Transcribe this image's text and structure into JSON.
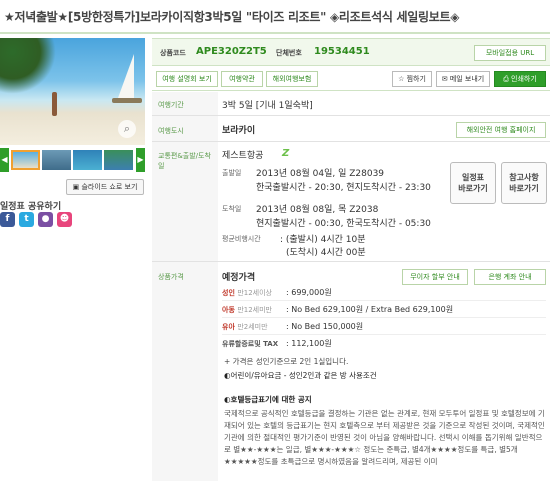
{
  "page": {
    "title": "★저녁출발★[5방한정특가]보라카이직항3박5일 \"타이즈 리조트\" ◈리조트석식 세일링보트◈"
  },
  "gallery": {
    "slideshow_label": "슬라이드 쇼로 보기",
    "share_label": "일정표 공유하기",
    "social": [
      {
        "icon": "facebook-icon",
        "glyph": "f",
        "color": "#3b5998"
      },
      {
        "icon": "twitter-icon",
        "glyph": "t",
        "color": "#2aa9e0"
      },
      {
        "icon": "messenger-icon",
        "glyph": "●",
        "color": "#7b4fa3"
      },
      {
        "icon": "kakao-icon",
        "glyph": "☻",
        "color": "#e8457c"
      }
    ]
  },
  "product": {
    "code_label": "상품코드",
    "code_value": "APE320Z2T5",
    "group_label": "단체번호",
    "group_value": "19534451",
    "mobile_url_label": "모바일접용 URL"
  },
  "tabs": [
    "여행 설명회 보기",
    "여행약관",
    "해외여행보험"
  ],
  "tools": {
    "bookmark": "☆ 찜하기",
    "mail": "✉ 메일 보내기",
    "print": "⎙ 인쇄하기"
  },
  "period": {
    "label": "여행기간",
    "value": "3박 5일 [기내 1일숙박]"
  },
  "city": {
    "label": "여행도시",
    "value": "보라카이",
    "safety_btn": "해외안전 여행 홈페이지"
  },
  "transport": {
    "label": "교통편&출발/도착일",
    "airline": "제스트항공",
    "airline_mark": "Z",
    "depart_label": "출발일",
    "depart_line1": "2013년 08월 04일, 일 Z28039",
    "depart_line2": "한국출발시간 - 20:30, 현지도착시간 - 23:30",
    "arrive_label": "도착일",
    "arrive_line1": "2013년 08월 08일, 목 Z2038",
    "arrive_line2": "현지출발시간 - 00:30, 한국도착시간 - 05:30",
    "flight_time_label": "평균비행시간",
    "flight_time_out": ": (출발시) 4시간 10분",
    "flight_time_back": "(도착시) 4시간 00분",
    "schedule_btn_line1": "일정표",
    "schedule_btn_line2": "바로가기",
    "ref_btn_line1": "참고사항",
    "ref_btn_line2": "바로가기"
  },
  "price": {
    "label": "상품가격",
    "heading": "예정가격",
    "no_interest_btn": "무이자 할부 안내",
    "bank_btn": "은행 계좌 안내",
    "rows": [
      {
        "name": "성인",
        "age": "만12세이상",
        "value": ": 699,000원"
      },
      {
        "name": "아동",
        "age": "만12세미만",
        "value": ": No Bed 629,100원 / Extra Bed 629,100원"
      },
      {
        "name": "유아",
        "age": "만2세미만",
        "value": ": No Bed 150,000원"
      },
      {
        "name": "유류할증료및 TAX",
        "age": "",
        "value": ": 112,100원"
      }
    ],
    "note1": "+ 가격은 성인기준으로 2인 1실입니다.",
    "note2": "◐어린이/유아요금 - 성인2인과 같은 방 사용조건",
    "hotel_heading": "◐호텔등급표기에 대한 공지",
    "hotel_text": "국제적으로 공식적인 호텔등급을 결정하는 기관은 없는 관계로, 현재 모두투어 일정표 및 호텔정보에 기재되어 있는 호텔의 등급표기는 현지 호텔측으로 부터 제공받은 것을 기준으로 작성된 것이며, 국제적인 기관에 의한 절대적인 평가기준이 반영된 것이 아님을 양해바랍니다. 선택시 이해를 돕기위해 일반적으로 별★★-★★★는 일급, 별★★★-★★★☆ 정도는 준특급, 별4개★★★★정도를 특급, 별5개 ★★★★★정도를 초특급으로 명시하였음을 알려드리며, 제공된 이미"
  }
}
